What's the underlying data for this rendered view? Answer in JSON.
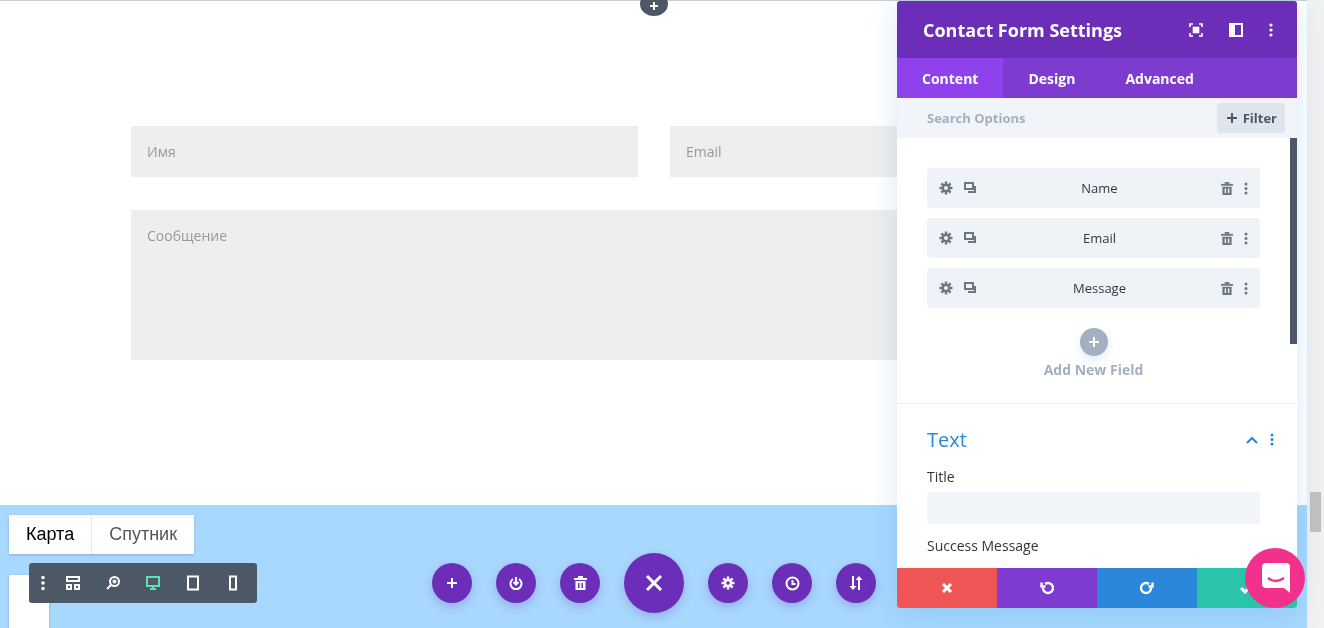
{
  "page": {
    "form": {
      "name_placeholder": "Имя",
      "email_placeholder": "Email",
      "message_placeholder": "Сообщение"
    }
  },
  "map": {
    "tabs": [
      {
        "label": "Карта",
        "selected": true
      },
      {
        "label": "Спутник",
        "selected": false
      }
    ]
  },
  "toolbar": {
    "items": [
      {
        "kind": "menu",
        "selected": false
      },
      {
        "kind": "layout",
        "selected": false
      },
      {
        "kind": "zoom",
        "selected": false
      },
      {
        "kind": "desktop",
        "selected": true
      },
      {
        "kind": "tablet",
        "selected": false
      },
      {
        "kind": "phone",
        "selected": false
      }
    ]
  },
  "actions": [
    {
      "kind": "add"
    },
    {
      "kind": "portability"
    },
    {
      "kind": "delete"
    },
    {
      "kind": "close"
    },
    {
      "kind": "settings"
    },
    {
      "kind": "history"
    },
    {
      "kind": "reorder"
    }
  ],
  "panel": {
    "title": "Contact Form Settings",
    "tabs": [
      {
        "label": "Content",
        "selected": true
      },
      {
        "label": "Design",
        "selected": false
      },
      {
        "label": "Advanced",
        "selected": false
      }
    ],
    "search": {
      "placeholder": "Search Options"
    },
    "filter": "Filter",
    "fields": [
      {
        "label": "Name"
      },
      {
        "label": "Email"
      },
      {
        "label": "Message"
      }
    ],
    "add_field": "Add New Field",
    "section": {
      "title": "Text",
      "expanded": true,
      "options": [
        {
          "label": "Title"
        },
        {
          "label": "Success Message"
        }
      ]
    },
    "footer": [
      {
        "kind": "discard"
      },
      {
        "kind": "undo"
      },
      {
        "kind": "redo"
      },
      {
        "kind": "save"
      }
    ]
  }
}
